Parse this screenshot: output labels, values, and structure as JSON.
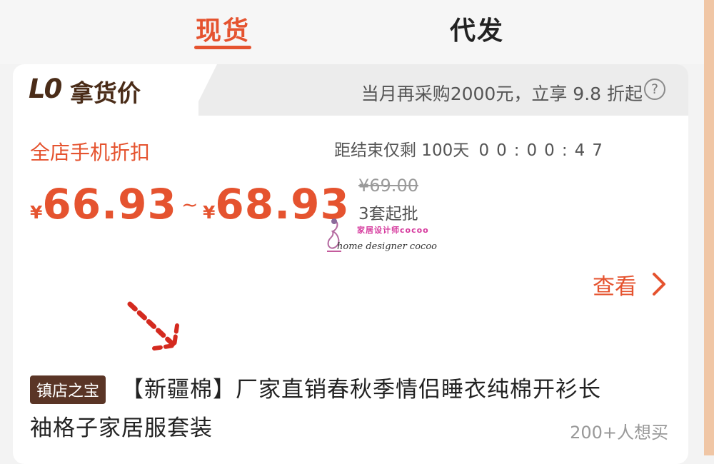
{
  "tabs": [
    {
      "label": "现货",
      "active": true
    },
    {
      "label": "代发",
      "active": false
    }
  ],
  "price_card": {
    "badge_logo": "L0",
    "title": "拿货价",
    "promo_text": "当月再采购2000元，立享 9.8 折起",
    "help_icon": "question-circle-icon",
    "discount_label": "全店手机折扣",
    "countdown_label": "距结束仅剩 100天",
    "countdown_time": "00:00:47",
    "currency": "¥",
    "price_low": "66.93",
    "price_separator": "~",
    "price_high": "68.93",
    "original_price": "¥69.00",
    "moq": "3套起批",
    "view_label": "查看",
    "view_icon": "chevron-right-icon"
  },
  "watermark": {
    "cn_text": "家居设计师cocoo",
    "en_text": "home designer cocoo"
  },
  "product": {
    "badge": "镇店之宝",
    "title_line1": "【新疆棉】厂家直销春秋季情侣睡衣纯棉开衫长",
    "title_line2": "袖格子家居服套装",
    "want_count": "200+人想买"
  },
  "colors": {
    "accent": "#e5532f",
    "brand_brown": "#4a2c18",
    "badge_brown": "#5a3526"
  }
}
